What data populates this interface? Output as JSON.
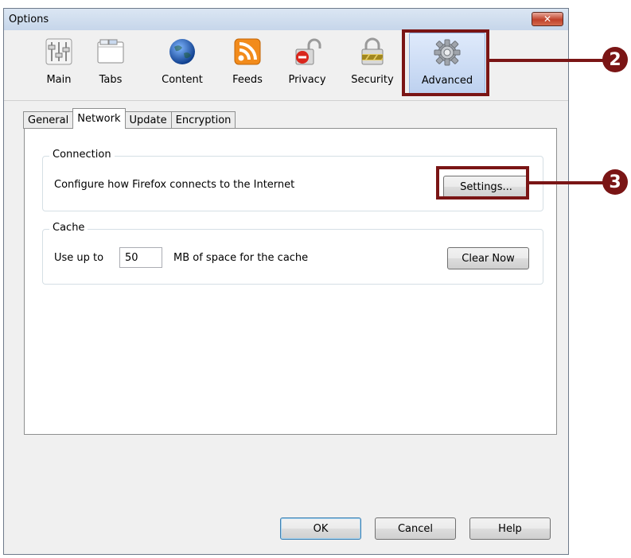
{
  "window": {
    "title": "Options"
  },
  "panes": [
    {
      "label": "Main"
    },
    {
      "label": "Tabs"
    },
    {
      "label": "Content"
    },
    {
      "label": "Feeds"
    },
    {
      "label": "Privacy"
    },
    {
      "label": "Security"
    },
    {
      "label": "Advanced"
    }
  ],
  "tabs": [
    {
      "label": "General"
    },
    {
      "label": "Network"
    },
    {
      "label": "Update"
    },
    {
      "label": "Encryption"
    }
  ],
  "connection": {
    "legend": "Connection",
    "description": "Configure how Firefox connects to the Internet",
    "settings_label": "Settings..."
  },
  "cache": {
    "legend": "Cache",
    "prefix": "Use up to",
    "value": "50",
    "suffix": "MB of space for the cache",
    "clear_label": "Clear Now"
  },
  "footer": {
    "ok_label": "OK",
    "cancel_label": "Cancel",
    "help_label": "Help"
  },
  "callouts": [
    "2",
    "3"
  ],
  "colors": {
    "callout": "#7a1515",
    "selected_pane": "#bcd0ef"
  }
}
